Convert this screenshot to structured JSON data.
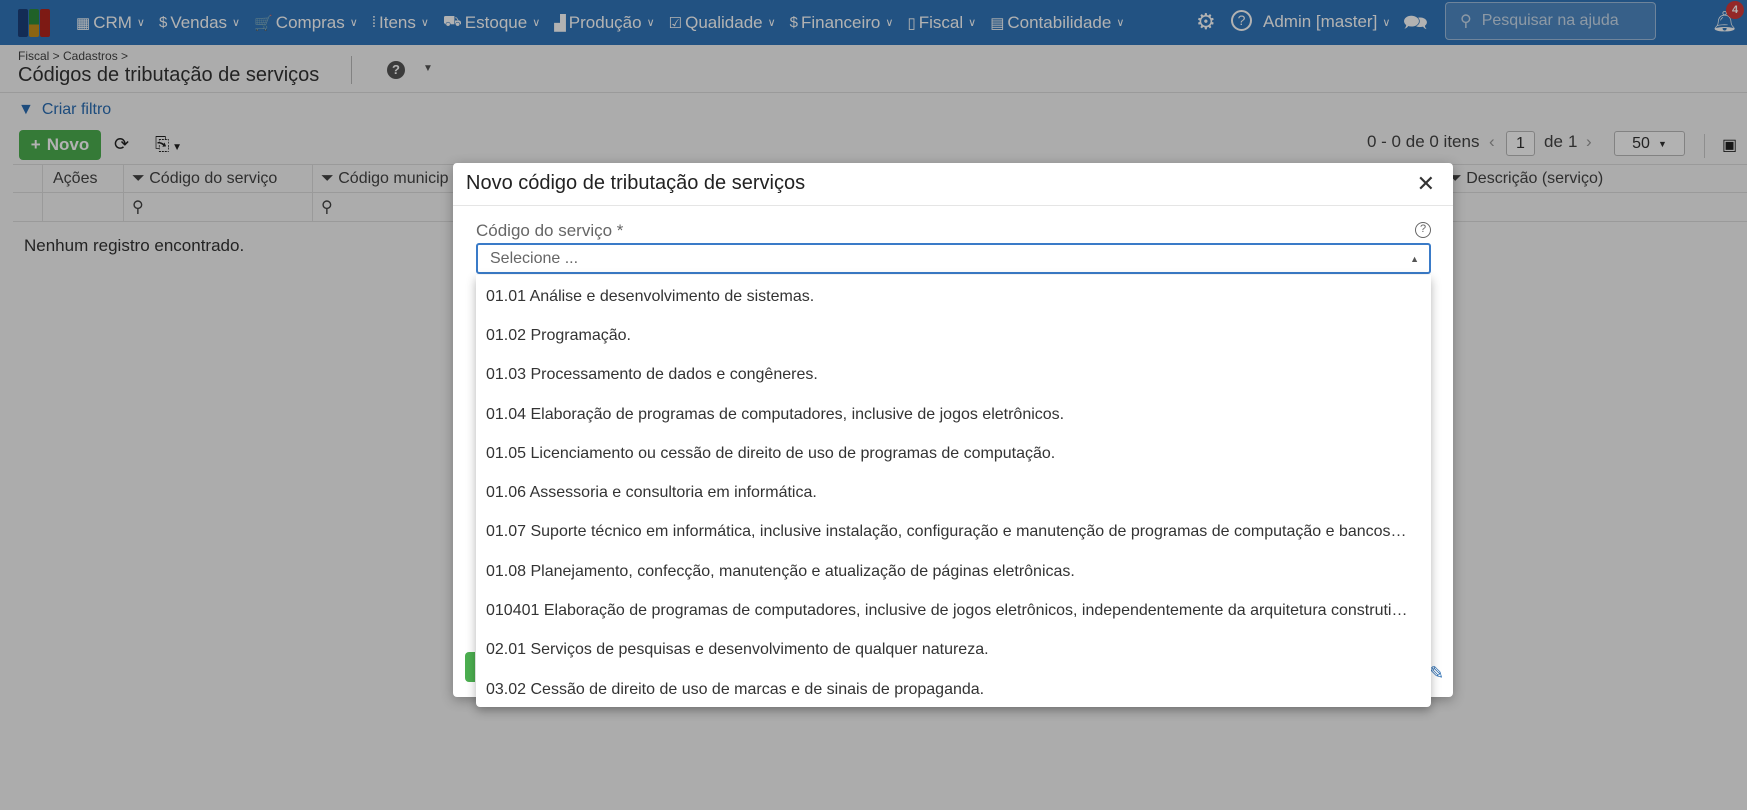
{
  "nav": {
    "menu": [
      {
        "label": "CRM",
        "icon": "crm-icon",
        "glyph": "▦"
      },
      {
        "label": "Vendas",
        "icon": "dollar-icon",
        "glyph": "$"
      },
      {
        "label": "Compras",
        "icon": "cart-icon",
        "glyph": "🛒"
      },
      {
        "label": "Itens",
        "icon": "items-icon",
        "glyph": "⁞"
      },
      {
        "label": "Estoque",
        "icon": "stock-icon",
        "glyph": "⛟"
      },
      {
        "label": "Produção",
        "icon": "factory-icon",
        "glyph": "▟"
      },
      {
        "label": "Qualidade",
        "icon": "checklist-icon",
        "glyph": "☑"
      },
      {
        "label": "Financeiro",
        "icon": "money-bag-icon",
        "glyph": "$"
      },
      {
        "label": "Fiscal",
        "icon": "document-icon",
        "glyph": "▯"
      },
      {
        "label": "Contabilidade",
        "icon": "calculator-icon",
        "glyph": "▤"
      }
    ],
    "user": "Admin [master]",
    "search_placeholder": "Pesquisar na ajuda",
    "notifications": "4"
  },
  "page": {
    "breadcrumb": "Fiscal > Cadastros >",
    "title": "Códigos de tributação de serviços",
    "create_filter": "Criar filtro",
    "new_button": "Novo",
    "pagination": {
      "summary": "0 - 0 de 0 itens",
      "page": "1",
      "of": "de",
      "total_pages": "1",
      "page_size": "50"
    }
  },
  "grid": {
    "columns": [
      "Ações",
      "Código do serviço",
      "Código municip",
      "Descrição (serviço)"
    ],
    "empty": "Nenhum registro encontrado."
  },
  "modal": {
    "title": "Novo código de tributação de serviços",
    "field_label": "Código do serviço *",
    "placeholder": "Selecione ...",
    "options": [
      "01.01 Análise e desenvolvimento de sistemas.",
      "01.02 Programação.",
      "01.03 Processamento de dados e congêneres.",
      "01.04 Elaboração de programas de computadores, inclusive de jogos eletrônicos.",
      "01.05 Licenciamento ou cessão de direito de uso de programas de computação.",
      "01.06 Assessoria e consultoria em informática.",
      "01.07 Suporte técnico em informática, inclusive instalação, configuração e manutenção de programas de computação e bancos…",
      "01.08 Planejamento, confecção, manutenção e atualização de páginas eletrônicas.",
      "010401 Elaboração de programas de computadores, inclusive de jogos eletrônicos, independentemente da arquitetura construti…",
      "02.01 Serviços de pesquisas e desenvolvimento de qualquer natureza.",
      "03.02 Cessão de direito de uso de marcas e de sinais de propaganda."
    ]
  },
  "colors": {
    "nav": "#3176ba",
    "accent": "#2a6db3",
    "success": "#4caf50"
  }
}
